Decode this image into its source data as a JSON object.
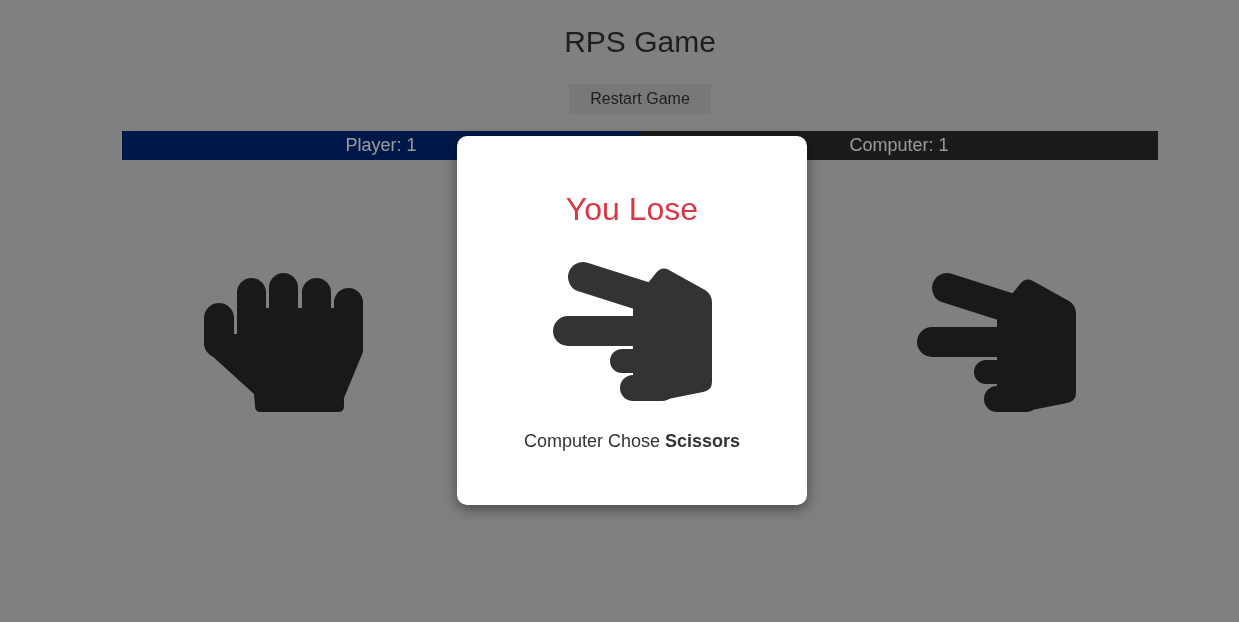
{
  "title": "RPS Game",
  "restart_button": {
    "label": "Restart Game"
  },
  "scoreboard": [
    {
      "kind": "player",
      "label": "Player: 1"
    },
    {
      "kind": "computer",
      "label": "Computer: 1"
    }
  ],
  "hands": [
    {
      "kind": "rock"
    },
    {
      "kind": "scissors"
    }
  ],
  "modal": {
    "kind": "lose",
    "title": "You Lose",
    "hand": {
      "kind": "scissors"
    },
    "message": "Computer Chose **Scissors**"
  }
}
